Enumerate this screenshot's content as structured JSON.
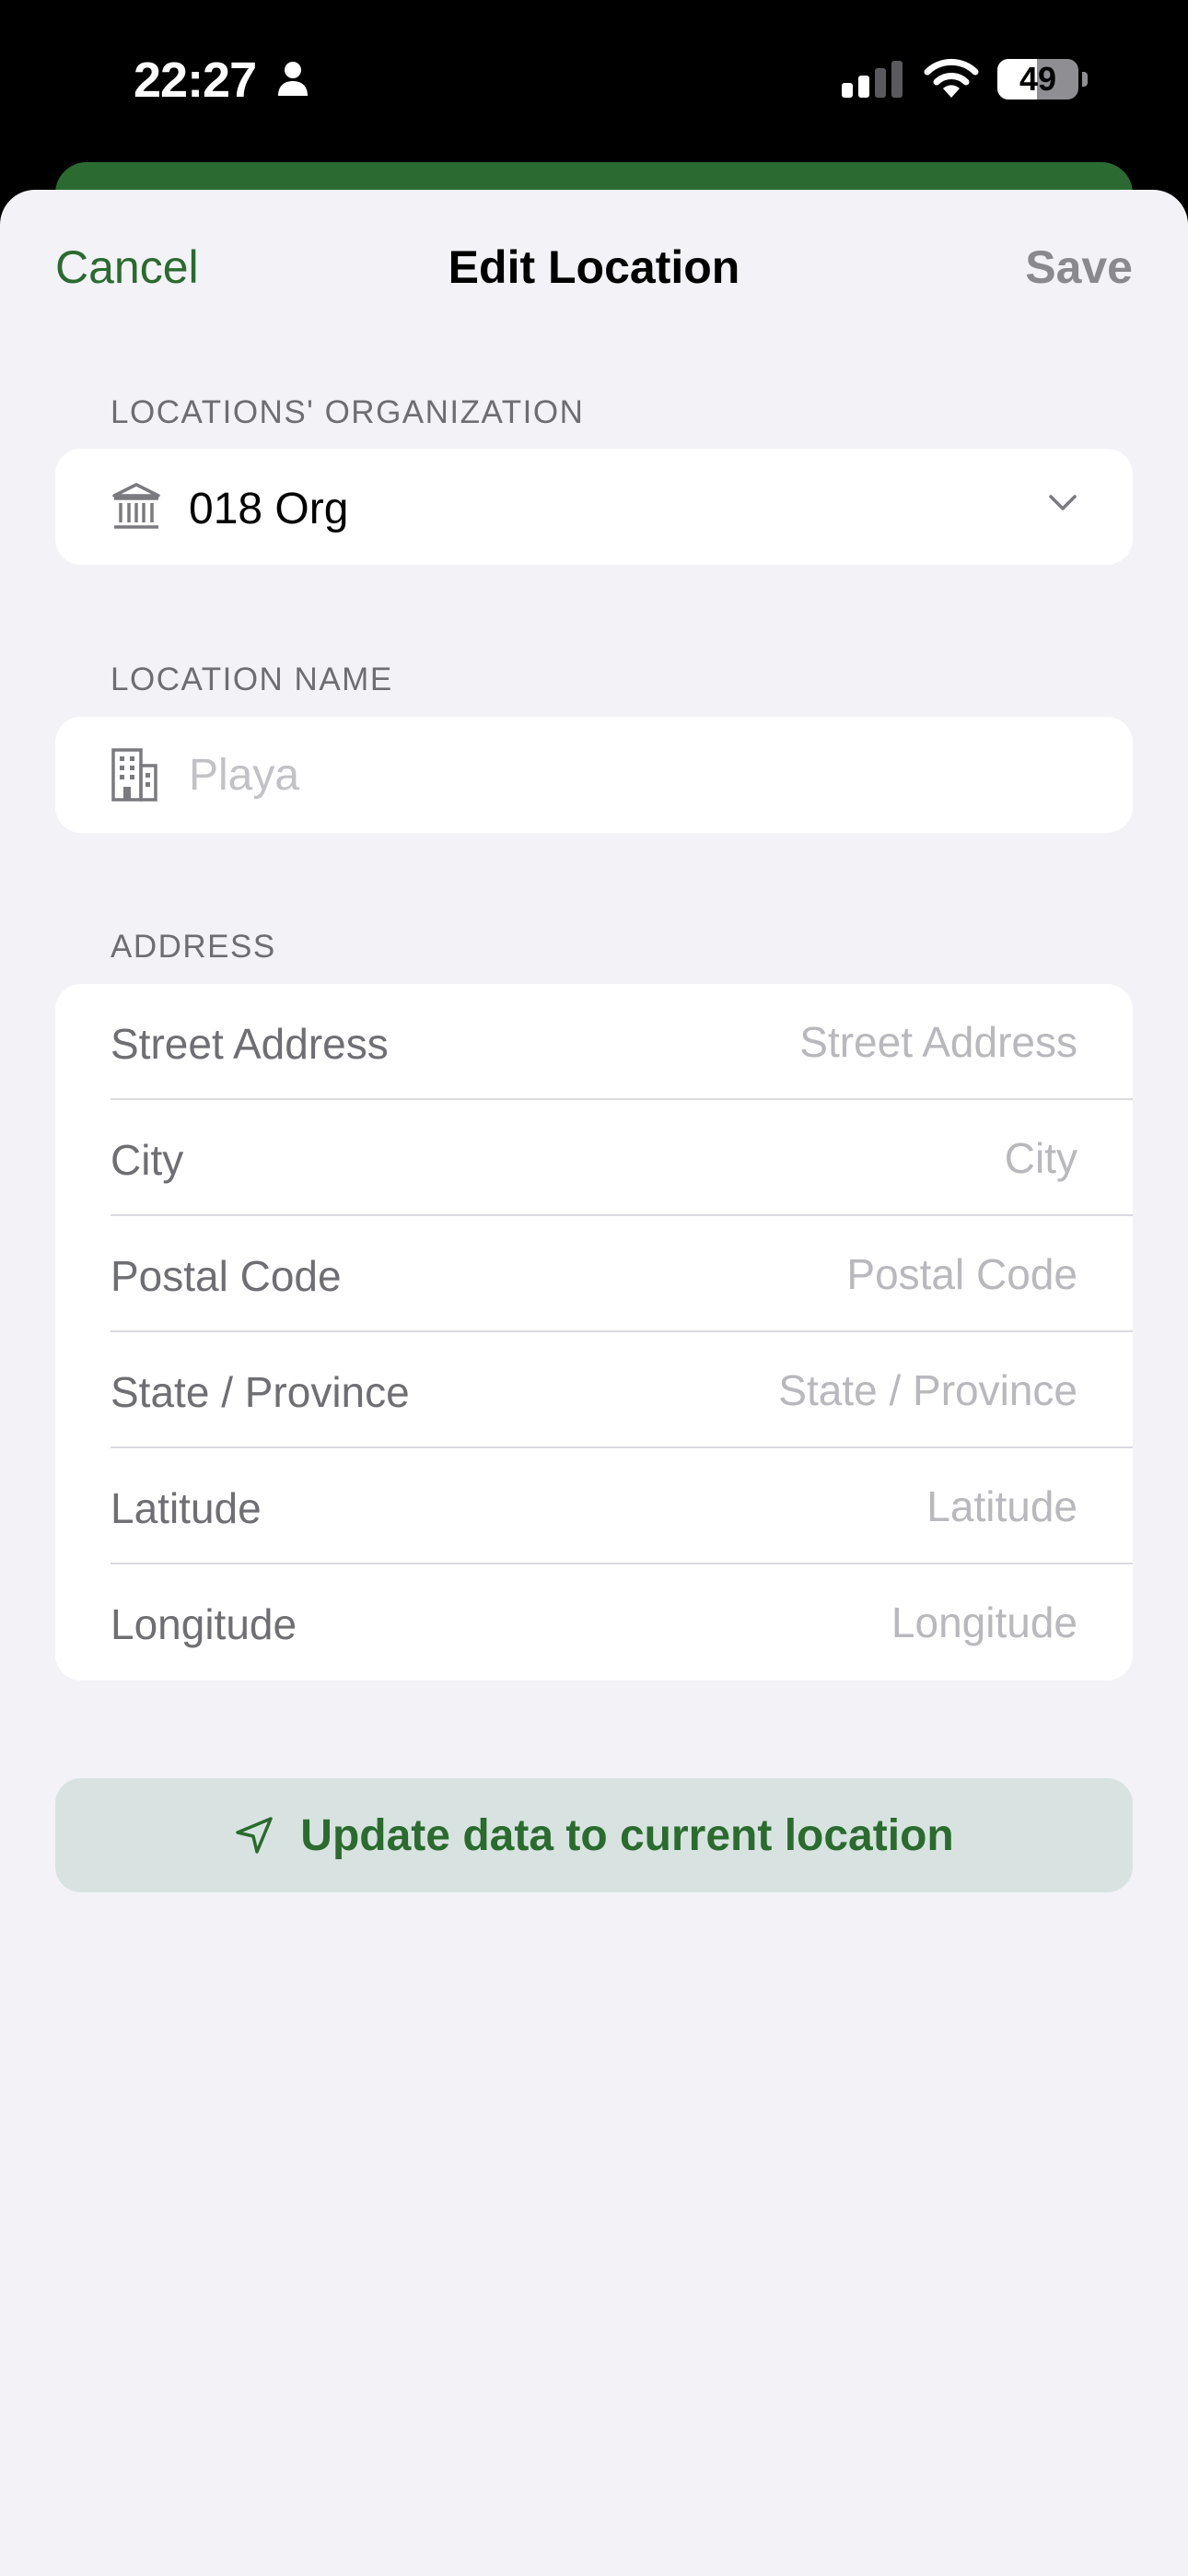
{
  "status_bar": {
    "time": "22:27",
    "battery_level": 49,
    "battery_text": "49"
  },
  "nav": {
    "cancel_label": "Cancel",
    "title": "Edit Location",
    "save_label": "Save"
  },
  "organization": {
    "header": "LOCATIONS' ORGANIZATION",
    "selected": "018 Org",
    "icon": "bank-building-icon"
  },
  "location_name": {
    "header": "LOCATION NAME",
    "placeholder": "Playa",
    "value": "",
    "icon": "building-icon"
  },
  "address": {
    "header": "ADDRESS",
    "fields": [
      {
        "label": "Street Address",
        "placeholder": "Street Address"
      },
      {
        "label": "City",
        "placeholder": "City"
      },
      {
        "label": "Postal Code",
        "placeholder": "Postal Code"
      },
      {
        "label": "State / Province",
        "placeholder": "State / Province"
      },
      {
        "label": "Latitude",
        "placeholder": "Latitude"
      },
      {
        "label": "Longitude",
        "placeholder": "Longitude"
      }
    ]
  },
  "actions": {
    "update_location_label": "Update data to current location",
    "icon": "location-arrow-icon"
  },
  "colors": {
    "accent": "#2a6b2e",
    "background": "#f2f2f7",
    "button_bg": "#d8e3e1",
    "disabled": "#8a8a8e"
  }
}
